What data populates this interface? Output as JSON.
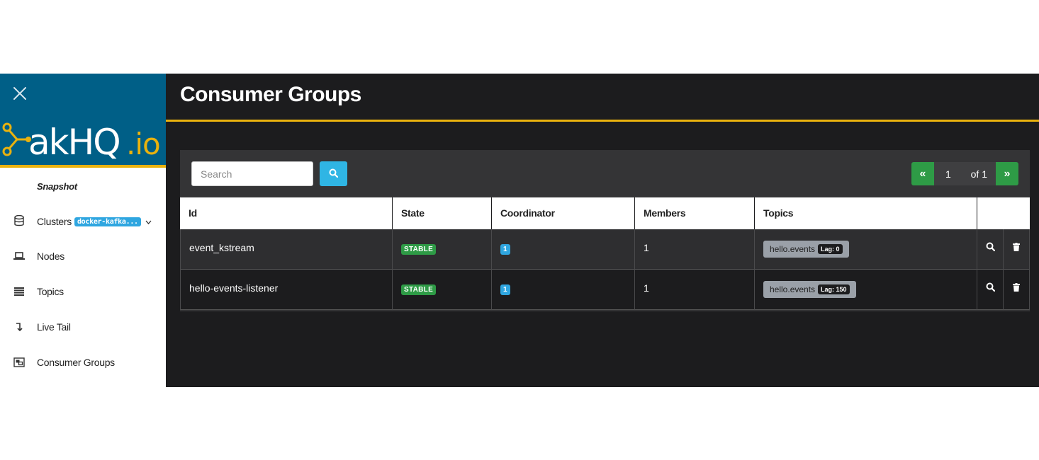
{
  "sidebar": {
    "snapshot_label": "Snapshot",
    "items": [
      {
        "label": "Clusters",
        "badge": "docker-kafka...",
        "icon": "database-icon"
      },
      {
        "label": "Nodes",
        "icon": "laptop-icon"
      },
      {
        "label": "Topics",
        "icon": "list-icon"
      },
      {
        "label": "Live Tail",
        "icon": "level-down-icon"
      },
      {
        "label": "Consumer Groups",
        "icon": "object-group-icon"
      }
    ]
  },
  "header": {
    "title": "Consumer Groups"
  },
  "search": {
    "placeholder": "Search",
    "value": ""
  },
  "pagination": {
    "first": "«",
    "current": "1",
    "total": "of 1",
    "last": "»"
  },
  "table": {
    "columns": [
      "Id",
      "State",
      "Coordinator",
      "Members",
      "Topics"
    ],
    "rows": [
      {
        "id": "event_kstream",
        "state": "STABLE",
        "coordinator": "1",
        "members": "1",
        "topic": "hello.events",
        "lag": "Lag: 0"
      },
      {
        "id": "hello-events-listener",
        "state": "STABLE",
        "coordinator": "1",
        "members": "1",
        "topic": "hello.events",
        "lag": "Lag: 150"
      }
    ]
  },
  "colors": {
    "accent": "#e9b20e",
    "brand": "#005f87",
    "success": "#2e9b46",
    "info": "#2fa6e0"
  }
}
